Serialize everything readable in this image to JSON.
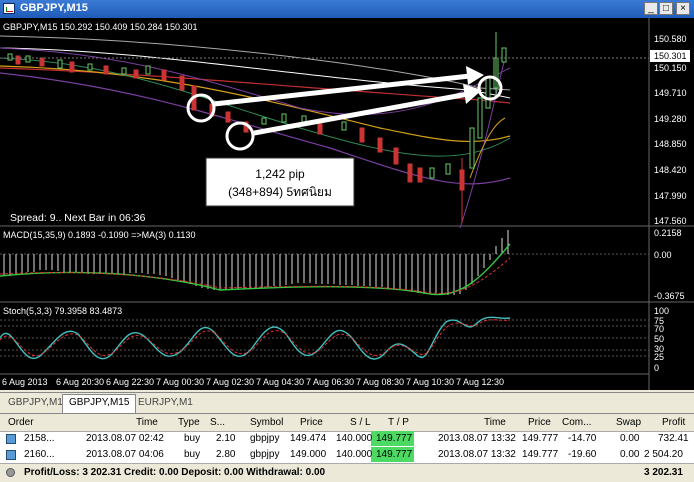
{
  "window": {
    "title": "GBPJPY,M15"
  },
  "chart": {
    "info": "GBPJPY,M15  150.292 150.409 150.284 150.301",
    "price_ticks": [
      "150.580",
      "150.301",
      "150.150",
      "149.710",
      "149.280",
      "148.850",
      "148.420",
      "147.990",
      "147.560"
    ],
    "spread_text": "Spread: 9.. Next Bar in 06:36",
    "annotation_line1": "1,242 pip",
    "annotation_line2": "(348+894) 5ทศนิยม",
    "macd_label": "MACD(15,35,9) 0.1893 -0.1090 =>MA(3) 0.1130",
    "macd_ticks": [
      "0.2158",
      "0.00",
      "-0.3675"
    ],
    "stoch_label": "Stoch(5,3,3) 79.3958 83.4873",
    "stoch_ticks": [
      "100",
      "75",
      "70",
      "50",
      "30",
      "25",
      "0"
    ],
    "time_ticks": [
      "6 Aug 2013",
      "6 Aug 20:30",
      "6 Aug 22:30",
      "7 Aug 00:30",
      "7 Aug 02:30",
      "7 Aug 04:30",
      "7 Aug 06:30",
      "7 Aug 08:30",
      "7 Aug 10:30",
      "7 Aug 12:30"
    ]
  },
  "tabs": [
    "GBPJPY,M15",
    "GBPJPY,M15",
    "EURJPY,M1"
  ],
  "terminal": {
    "headers": [
      "Order",
      "Time",
      "Type",
      "S...",
      "Symbol",
      "Price",
      "S / L",
      "T / P",
      "Time",
      "Price",
      "Com...",
      "Swap",
      "Profit"
    ],
    "rows": [
      {
        "order": "2158...",
        "time": "2013.08.07 02:42",
        "type": "buy",
        "size": "2.10",
        "symbol": "gbpjpy",
        "price": "149.474",
        "sl": "140.000",
        "tp": "149.777",
        "close_time": "2013.08.07 13:32",
        "close_price": "149.777",
        "commission": "-14.70",
        "swap": "0.00",
        "profit": "732.41"
      },
      {
        "order": "2160...",
        "time": "2013.08.07 04:06",
        "type": "buy",
        "size": "2.80",
        "symbol": "gbpjpy",
        "price": "149.000",
        "sl": "140.000",
        "tp": "149.777",
        "close_time": "2013.08.07 13:32",
        "close_price": "149.777",
        "commission": "-19.60",
        "swap": "0.00",
        "profit": "2 504.20"
      }
    ],
    "summary": "Profit/Loss: 3 202.31  Credit: 0.00  Deposit: 0.00  Withdrawal: 0.00",
    "total": "3 202.31",
    "tp_color": "#4cd964"
  }
}
